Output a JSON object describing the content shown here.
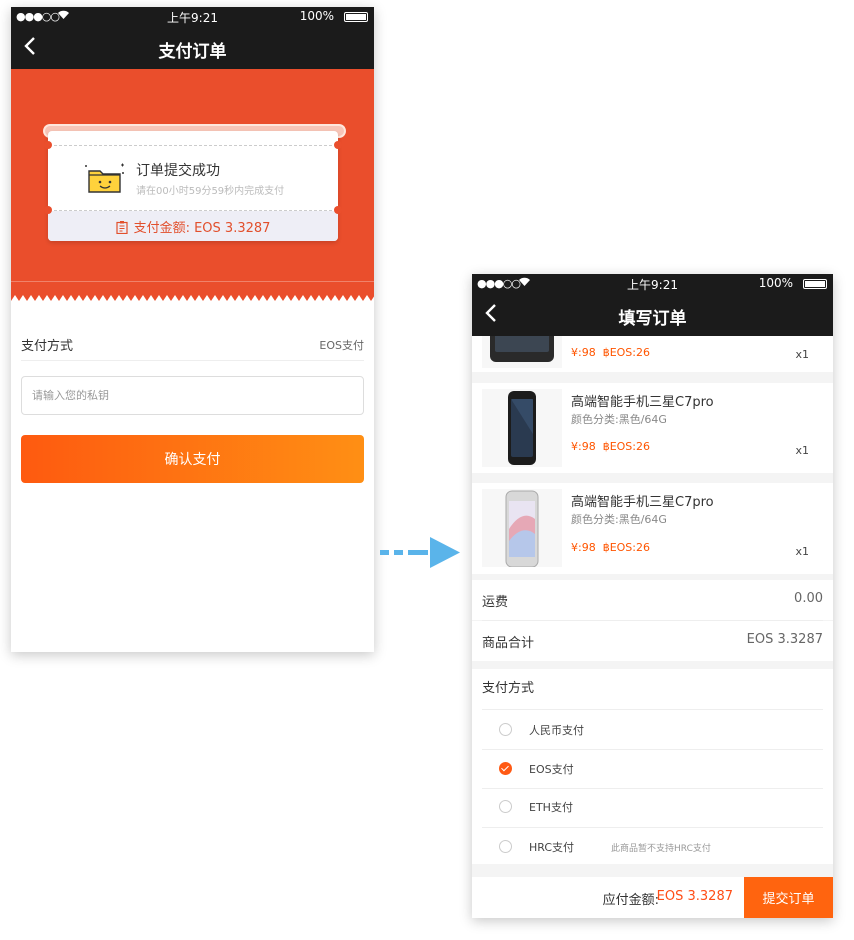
{
  "left_phone": {
    "status": {
      "signal": "●●●○○",
      "time": "上午9:21",
      "battery": "100%"
    },
    "nav": {
      "back": "‹",
      "title": "支付订单"
    },
    "ticket": {
      "success_text": "订单提交成功",
      "countdown_hint": "请在00小时59分59秒内完成支付",
      "amount_label": "支付金额:",
      "amount_value": "EOS 3.3287"
    },
    "payment_method": {
      "label": "支付方式",
      "value": "EOS支付"
    },
    "private_key": {
      "placeholder": "请输入您的私钥",
      "value": ""
    },
    "confirm_button": "确认支付"
  },
  "right_phone": {
    "status": {
      "signal": "●●●○○",
      "time": "上午9:21",
      "battery": "100%"
    },
    "nav": {
      "back": "‹",
      "title": "填写订单"
    },
    "items": [
      {
        "name": "",
        "spec": "",
        "price_cny": "¥:98",
        "price_eos": "฿EOS:26",
        "qty": "x1"
      },
      {
        "name": "高端智能手机三星C7pro",
        "spec": "颜色分类:黑色/64G",
        "price_cny": "¥:98",
        "price_eos": "฿EOS:26",
        "qty": "x1"
      },
      {
        "name": "高端智能手机三星C7pro",
        "spec": "颜色分类:黑色/64G",
        "price_cny": "¥:98",
        "price_eos": "฿EOS:26",
        "qty": "x1"
      }
    ],
    "shipping": {
      "label": "运费",
      "value": "0.00"
    },
    "subtotal": {
      "label": "商品合计",
      "value": "EOS 3.3287"
    },
    "payment": {
      "title": "支付方式",
      "options": [
        {
          "label": "人民币支付",
          "selected": false,
          "note": ""
        },
        {
          "label": "EOS支付",
          "selected": true,
          "note": ""
        },
        {
          "label": "ETH支付",
          "selected": false,
          "note": ""
        },
        {
          "label": "HRC支付",
          "selected": false,
          "note": "此商品暂不支持HRC支付"
        }
      ]
    },
    "footer": {
      "total_label": "应付金额:",
      "total_value": "EOS 3.3287",
      "submit_button": "提交订单"
    }
  },
  "colors": {
    "accent_orange": "#ea4e2c",
    "button_orange": "#ff640f",
    "dark_bar": "#1b1b1b",
    "flow_arrow": "#5ab4ea"
  }
}
